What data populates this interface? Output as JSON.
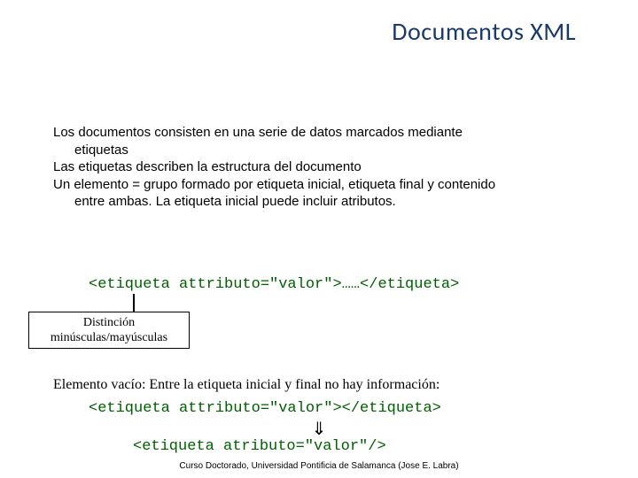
{
  "title": "Documentos XML",
  "body": {
    "line1": "Los documentos consisten en una serie de datos marcados mediante",
    "line1_indent": "etiquetas",
    "line2": "Las etiquetas describen la estructura del documento",
    "line3": "Un elemento = grupo formado por etiqueta inicial, etiqueta final y contenido",
    "line3_indent": "entre ambas. La etiqueta inicial puede incluir atributos."
  },
  "code1": "<etiqueta attributo=\"valor\">……</etiqueta>",
  "callout": "Distinción minúsculas/mayúsculas",
  "empty_el": "Elemento vacío: Entre la etiqueta inicial y final no hay información:",
  "code2": "<etiqueta attributo=\"valor\"></etiqueta>",
  "arrow": "⇓",
  "code3": "<etiqueta atributo=\"valor\"/>",
  "footer": "Curso Doctorado, Universidad Pontificia de Salamanca (Jose E. Labra)"
}
